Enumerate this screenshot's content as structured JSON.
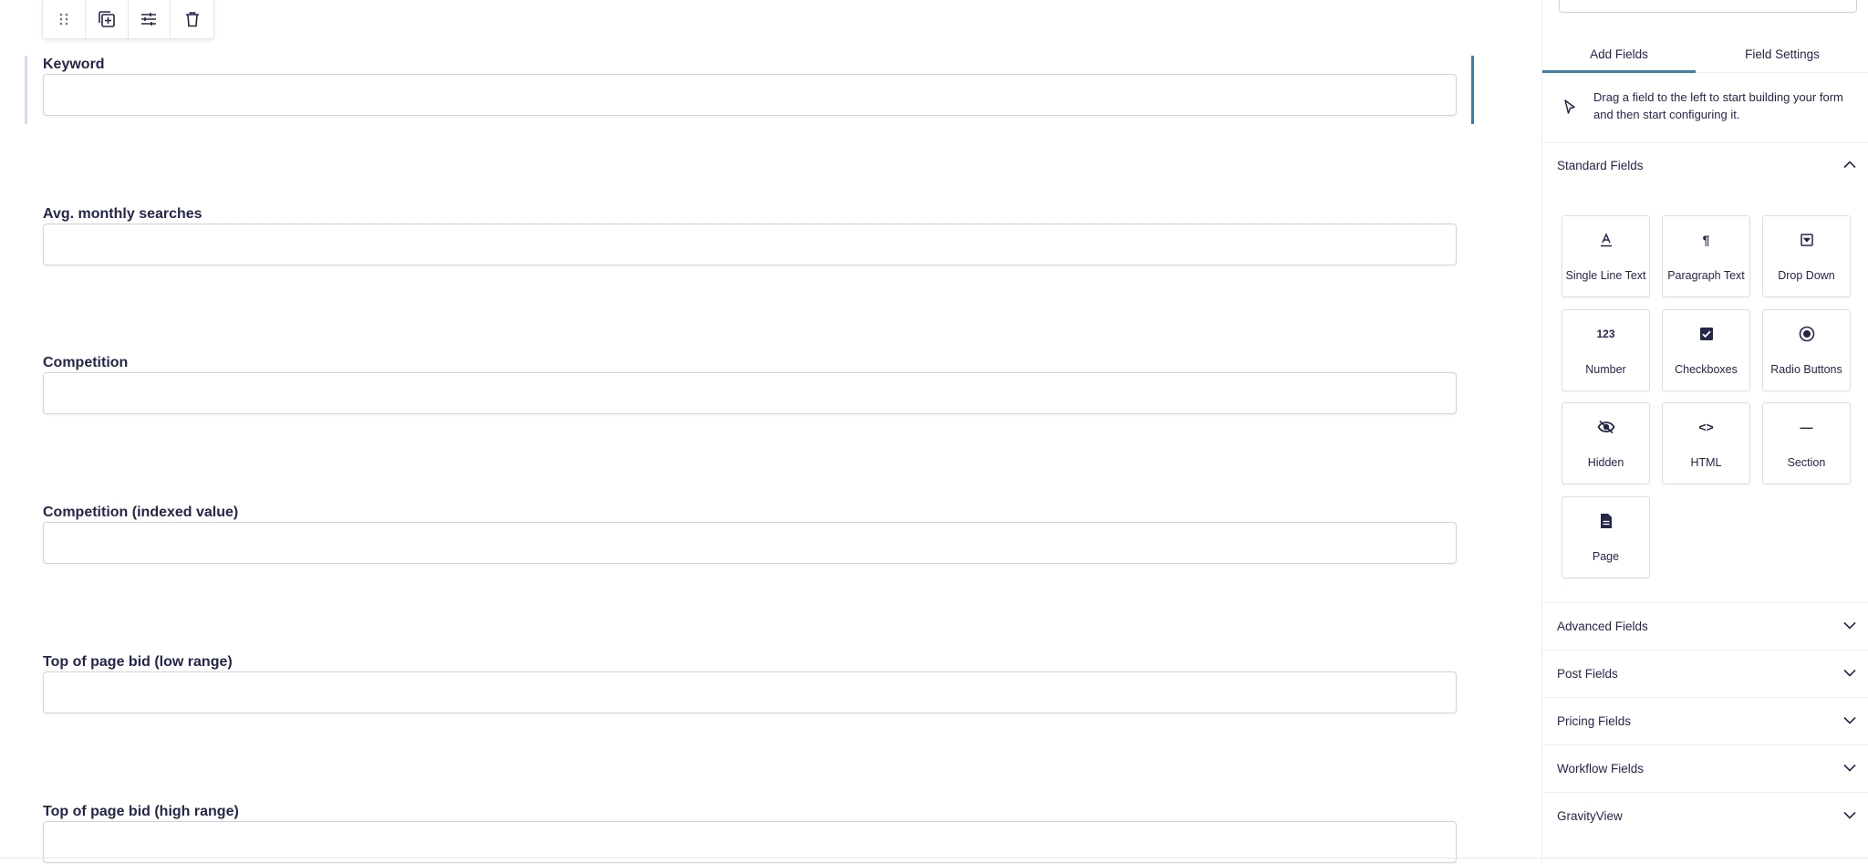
{
  "editor": {
    "toolbar": {
      "buttons": [
        {
          "name": "drag-handle-icon"
        },
        {
          "name": "duplicate-icon"
        },
        {
          "name": "settings-sliders-icon"
        },
        {
          "name": "trash-icon"
        }
      ]
    },
    "fields": [
      {
        "label": "Keyword",
        "value": "",
        "selected": true
      },
      {
        "label": "Avg. monthly searches",
        "value": ""
      },
      {
        "label": "Competition",
        "value": ""
      },
      {
        "label": "Competition (indexed value)",
        "value": ""
      },
      {
        "label": "Top of page bid (low range)",
        "value": ""
      },
      {
        "label": "Top of page bid (high range)",
        "value": ""
      }
    ]
  },
  "sidebar": {
    "tabs": [
      {
        "label": "Add Fields",
        "active": true
      },
      {
        "label": "Field Settings",
        "active": false
      }
    ],
    "hint": "Drag a field to the left to start building your form and then start configuring it.",
    "standard": {
      "title": "Standard Fields",
      "expanded": true,
      "items": [
        {
          "label": "Single Line Text",
          "icon": "single-line-text-icon"
        },
        {
          "label": "Paragraph Text",
          "icon": "paragraph-icon",
          "glyph": "¶"
        },
        {
          "label": "Drop Down",
          "icon": "dropdown-icon"
        },
        {
          "label": "Number",
          "icon": "number-icon",
          "glyph": "123"
        },
        {
          "label": "Checkboxes",
          "icon": "checkbox-icon"
        },
        {
          "label": "Radio Buttons",
          "icon": "radio-icon"
        },
        {
          "label": "Hidden",
          "icon": "hidden-eye-icon"
        },
        {
          "label": "HTML",
          "icon": "code-icon",
          "glyph": "<>"
        },
        {
          "label": "Section",
          "icon": "section-dash-icon",
          "glyph": "—"
        },
        {
          "label": "Page",
          "icon": "page-icon"
        }
      ]
    },
    "groups": [
      {
        "label": "Advanced Fields"
      },
      {
        "label": "Post Fields"
      },
      {
        "label": "Pricing Fields"
      },
      {
        "label": "Workflow Fields"
      },
      {
        "label": "GravityView"
      }
    ]
  },
  "colors": {
    "accent": "#3e7da6",
    "text": "#242748",
    "border": "#d0d3dc"
  }
}
